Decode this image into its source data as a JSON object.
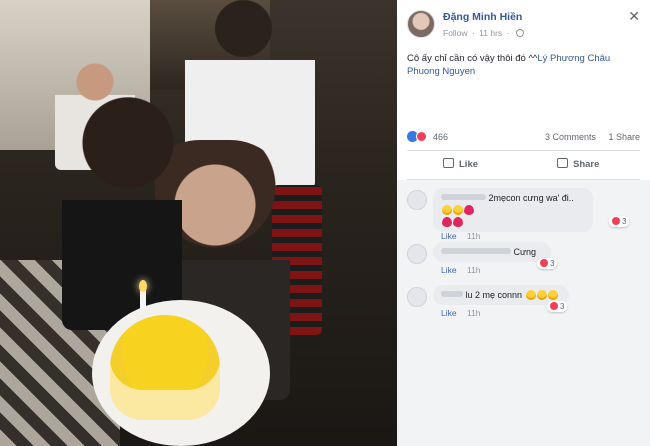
{
  "post": {
    "author": "Đặng Minh Hiền",
    "follow": "Follow",
    "time": "11 hrs",
    "text_main": "Cô ấy chỉ cần có vậy thôi đó ^^",
    "mention_1": "Lý Phương Châu",
    "mention_2": "Phuong Nguyen"
  },
  "stats": {
    "reactions": "466",
    "comments": "3 Comments",
    "shares": "1 Share"
  },
  "actions": {
    "like": "Like",
    "share": "Share"
  },
  "comments": [
    {
      "text": "2mẹcon cưng wa' đi..",
      "reacts": "3",
      "like": "Like",
      "time": "11h"
    },
    {
      "text": "Cưng",
      "reacts": "3",
      "like": "Like",
      "time": "11h"
    },
    {
      "text": "lu 2 mẹ connn",
      "reacts": "3",
      "like": "Like",
      "time": "11h"
    }
  ],
  "colors": {
    "link": "#365899",
    "background_comments": "#f2f3f5",
    "love": "#f33e58",
    "like": "#3578e5"
  },
  "icons": [
    "globe-icon",
    "close-icon",
    "like-icon",
    "share-icon"
  ]
}
